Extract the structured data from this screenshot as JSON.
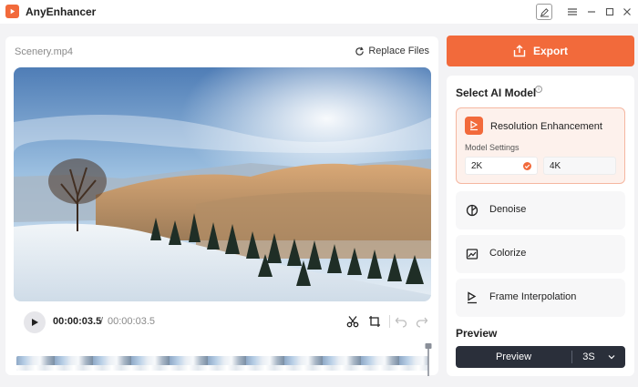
{
  "app": {
    "title": "AnyEnhancer"
  },
  "editor": {
    "file_name": "Scenery.mp4",
    "replace_label": "Replace Files",
    "time_current": "00:00:03.5",
    "time_separator": "/",
    "time_total": "00:00:03.5"
  },
  "sidebar": {
    "export_label": "Export",
    "ai_title": "Select AI Model",
    "models": [
      {
        "label": "Resolution Enhancement",
        "settings_label": "Model Settings",
        "options": [
          "2K",
          "4K"
        ],
        "selected": "2K"
      },
      {
        "label": "Denoise"
      },
      {
        "label": "Colorize"
      },
      {
        "label": "Frame Interpolation"
      }
    ],
    "preview_title": "Preview",
    "preview_button": "Preview",
    "preview_duration": "3S"
  },
  "colors": {
    "accent": "#f26a3b",
    "dark_button": "#2a2f3a",
    "active_card_bg": "#fdf1ec"
  }
}
